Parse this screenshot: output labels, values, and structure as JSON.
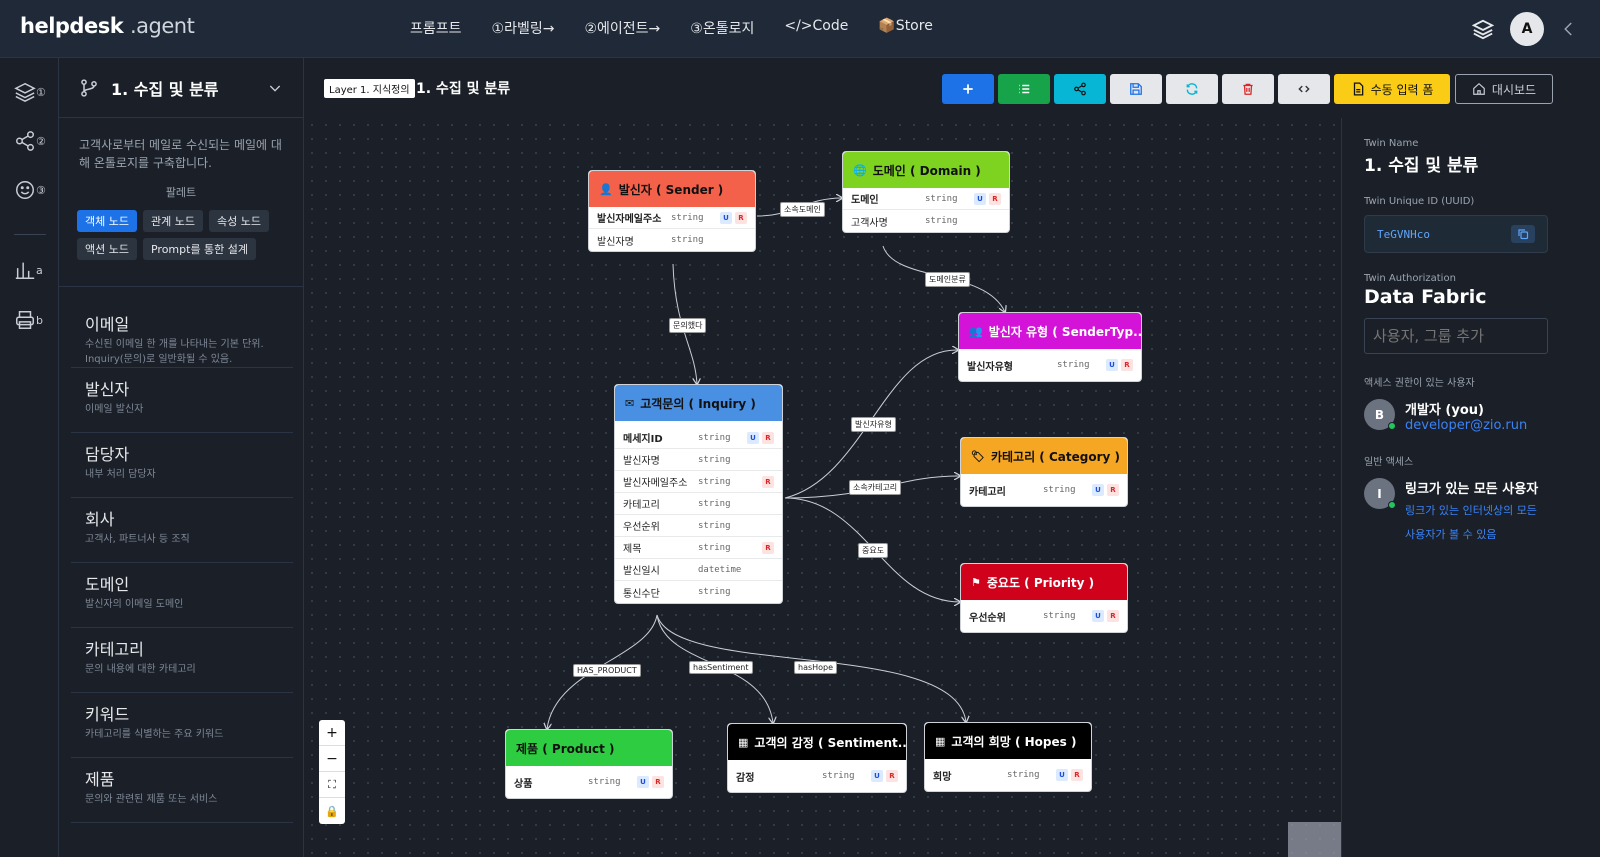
{
  "app": {
    "brand_main": "helpdesk",
    "brand_sub": ".agent",
    "avatar_letter": "A"
  },
  "nav": {
    "items": [
      "프롬프트",
      "①라벨링→",
      "②에이전트→",
      "③온톨로지",
      "</>Code",
      "📦Store"
    ]
  },
  "rail": {
    "items": [
      {
        "icon": "layers-icon",
        "num": "①"
      },
      {
        "icon": "share-icon",
        "num": "②"
      },
      {
        "icon": "smile-icon",
        "num": "③"
      },
      {
        "icon": "bar-chart-icon",
        "num": "a"
      },
      {
        "icon": "printer-icon",
        "num": "b"
      }
    ]
  },
  "sidebar": {
    "title": "1. 수집 및 분류",
    "description": "고객사로부터 메일로 수신되는 메일에 대해 온톨로지를 구축합니다.",
    "palette_label": "팔레트",
    "chips": [
      "객체 노드",
      "관계 노드",
      "속성 노드",
      "액션 노드",
      "Prompt를 통한 설계"
    ],
    "items": [
      {
        "title": "이메일",
        "desc": "수신된 이메일 한 개를 나타내는 기본 단위. Inquiry(문의)로 일반화될 수 있음."
      },
      {
        "title": "발신자",
        "desc": "이메일 발신자"
      },
      {
        "title": "담당자",
        "desc": "내부 처리 담당자"
      },
      {
        "title": "회사",
        "desc": "고객사, 파트너사 등 조직"
      },
      {
        "title": "도메인",
        "desc": "발신자의 이메일 도메인"
      },
      {
        "title": "카테고리",
        "desc": "문의 내용에 대한 카테고리"
      },
      {
        "title": "키워드",
        "desc": "카테고리를 식별하는 주요 키워드"
      },
      {
        "title": "제품",
        "desc": "문의와 관련된 제품 또는 서비스"
      }
    ]
  },
  "toolbar": {
    "layer_tag": "Layer 1. 지식정의",
    "title": "1. 수집 및 분류",
    "manual_input_label": "수동 입력 폼",
    "dashboard_label": "대시보드",
    "colors": {
      "add": "#1d72e8",
      "list": "#16a34a",
      "share": "#06b6d4",
      "save": "#e5e7eb",
      "refresh": "#e5e7eb",
      "delete": "#e5e7eb",
      "code": "#e5e7eb",
      "manual": "#facc15"
    }
  },
  "nodes": {
    "sender": {
      "title": "발신자 ( Sender )",
      "color": "#f4614a",
      "icon": "user-icon",
      "attrs": [
        {
          "name": "발신자메일주소",
          "type": "string",
          "u": true,
          "r": true,
          "key": true
        },
        {
          "name": "발신자명",
          "type": "string",
          "u": false,
          "r": false
        }
      ]
    },
    "domain": {
      "title": "도메인 ( Domain )",
      "color": "#7ed321",
      "icon": "globe-icon",
      "attrs": [
        {
          "name": "도메인",
          "type": "string",
          "u": true,
          "r": true,
          "key": true
        },
        {
          "name": "고객사명",
          "type": "string",
          "u": false,
          "r": false
        }
      ]
    },
    "sendertype": {
      "title": "발신자 유형 ( SenderTyp...",
      "color": "#d314d8",
      "icon": "users-icon",
      "attrs": [
        {
          "name": "발신자유형",
          "type": "string",
          "u": true,
          "r": true,
          "key": true
        }
      ]
    },
    "inquiry": {
      "title": "고객문의 ( Inquiry )",
      "color": "#4a90e2",
      "icon": "mail-icon",
      "attrs": [
        {
          "name": "메세지ID",
          "type": "string",
          "u": true,
          "r": true,
          "key": true
        },
        {
          "name": "발신자명",
          "type": "string",
          "u": false,
          "r": false
        },
        {
          "name": "발신자메일주소",
          "type": "string",
          "u": false,
          "r": true
        },
        {
          "name": "카테고리",
          "type": "string",
          "u": false,
          "r": false
        },
        {
          "name": "우선순위",
          "type": "string",
          "u": false,
          "r": false
        },
        {
          "name": "제목",
          "type": "string",
          "u": false,
          "r": true
        },
        {
          "name": "발신일시",
          "type": "datetime",
          "u": false,
          "r": false
        },
        {
          "name": "통신수단",
          "type": "string",
          "u": false,
          "r": false
        }
      ]
    },
    "category": {
      "title": "카테고리 ( Category )",
      "color": "#f5a623",
      "icon": "tag-icon",
      "attrs": [
        {
          "name": "카테고리",
          "type": "string",
          "u": true,
          "r": true,
          "key": true
        }
      ]
    },
    "priority": {
      "title": "중요도 ( Priority )",
      "color": "#d0021b",
      "icon": "flag-icon",
      "attrs": [
        {
          "name": "우선순위",
          "type": "string",
          "u": true,
          "r": true,
          "key": true
        }
      ]
    },
    "product": {
      "title": "제품 ( Product )",
      "color": "#2ecc40",
      "icon": "",
      "attrs": [
        {
          "name": "상품",
          "type": "string",
          "u": true,
          "r": true,
          "key": true
        }
      ]
    },
    "sentiment": {
      "title": "고객의 감정 ( Sentiment...",
      "color": "#000000",
      "icon": "table-icon",
      "attrs": [
        {
          "name": "감정",
          "type": "string",
          "u": true,
          "r": true,
          "key": true
        }
      ]
    },
    "hopes": {
      "title": "고객의 희망 ( Hopes )",
      "color": "#000000",
      "icon": "table-icon",
      "attrs": [
        {
          "name": "희망",
          "type": "string",
          "u": true,
          "r": true,
          "key": true
        }
      ]
    }
  },
  "edges": {
    "sender_domain": "소속도메인",
    "domain_sendertype": "도메인분류",
    "sender_inquiry": "문의했다",
    "inquiry_sendertype": "발신자유형",
    "inquiry_category": "소속카테고리",
    "inquiry_priority": "중요도",
    "inquiry_product": "HAS_PRODUCT",
    "inquiry_sentiment": "hasSentiment",
    "inquiry_hopes": "hasHope"
  },
  "panel": {
    "twin_name_label": "Twin Name",
    "twin_name": "1. 수집 및 분류",
    "uuid_label": "Twin Unique ID (UUID)",
    "uuid": "TeGVNHco",
    "auth_label": "Twin Authorization",
    "auth_value": "Data Fabric",
    "add_placeholder": "사용자, 그룹 추가",
    "access_users_label": "액세스 권한이 있는 사용자",
    "user_letter": "B",
    "user_name": "개발자 (you)",
    "user_email": "developer@zio.run",
    "general_access_label": "일반 액세스",
    "general_letter": "I",
    "general_title": "링크가 있는 모든 사용자",
    "general_desc": "링크가 있는 인터넷상의 모든 사용자가 볼 수 있음"
  }
}
